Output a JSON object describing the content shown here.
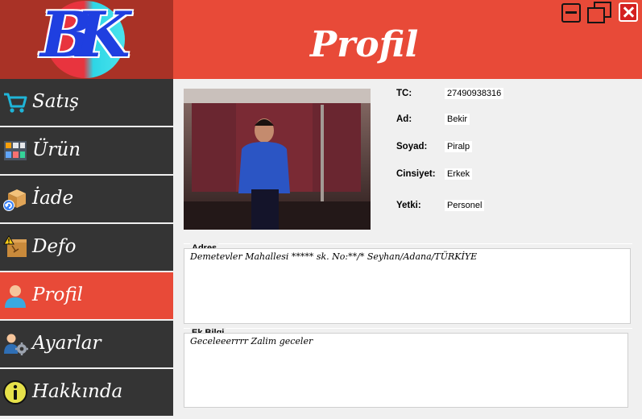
{
  "logo": {
    "text": "BK"
  },
  "header": {
    "title": "Profil"
  },
  "window_controls": {
    "minimize": "minimize-icon",
    "maximize": "restore-icon",
    "close": "close-icon"
  },
  "sidebar": {
    "items": [
      {
        "label": "Satış",
        "icon": "cart-icon"
      },
      {
        "label": "Ürün",
        "icon": "products-icon"
      },
      {
        "label": "İade",
        "icon": "return-icon"
      },
      {
        "label": "Defo",
        "icon": "defect-icon"
      },
      {
        "label": "Profil",
        "icon": "user-icon",
        "active": true
      },
      {
        "label": "Ayarlar",
        "icon": "settings-icon"
      },
      {
        "label": "Hakkında",
        "icon": "info-icon"
      }
    ]
  },
  "profile": {
    "tc_label": "TC:",
    "tc_value": "27490938316",
    "ad_label": "Ad:",
    "ad_value": "Bekir",
    "soyad_label": "Soyad:",
    "soyad_value": "Piralp",
    "cinsiyet_label": "Cinsiyet:",
    "cinsiyet_value": "Erkek",
    "yetki_label": "Yetki:",
    "yetki_value": "Personel"
  },
  "address": {
    "title": "Adres",
    "value": "Demetevler Mahallesi ***** sk. No:**/* Seyhan/Adana/TÜRKİYE"
  },
  "extra": {
    "title": "Ek Bilgi",
    "value": "Geceleeerrrr Zalim geceler"
  },
  "colors": {
    "accent": "#e84a38",
    "sidebar_dark": "#343434",
    "logo_bg": "#a93226"
  }
}
